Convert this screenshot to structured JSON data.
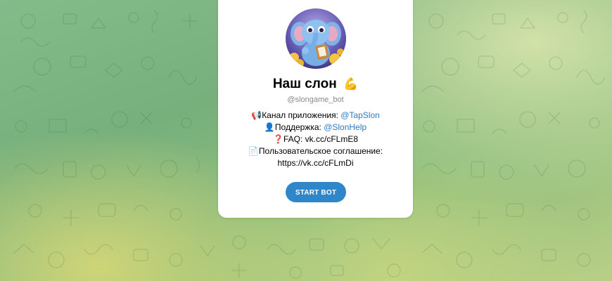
{
  "bot": {
    "name": "Наш слон",
    "name_emoji": "💪",
    "username": "@slongame_bot"
  },
  "description": {
    "line1": {
      "emoji": "📢",
      "label": "Канал приложения: ",
      "link": "@TapSlon"
    },
    "line2": {
      "emoji": "👤",
      "label": "Поддержка: ",
      "link": "@SlonHelp"
    },
    "line3": {
      "emoji": "❓",
      "label": "FAQ: vk.cc/cFLmE8"
    },
    "line4": {
      "emoji": "📄",
      "label": "Пользовательское соглашение:"
    },
    "line5": {
      "label": "https://vk.cc/cFLmDi"
    }
  },
  "start_button": {
    "label": "START BOT"
  },
  "colors": {
    "accent": "#2f86c9",
    "link": "#2e7bc4",
    "muted": "#8a8a8a",
    "bg_green": "#77b07c",
    "bg_yellow": "#d2d678"
  }
}
